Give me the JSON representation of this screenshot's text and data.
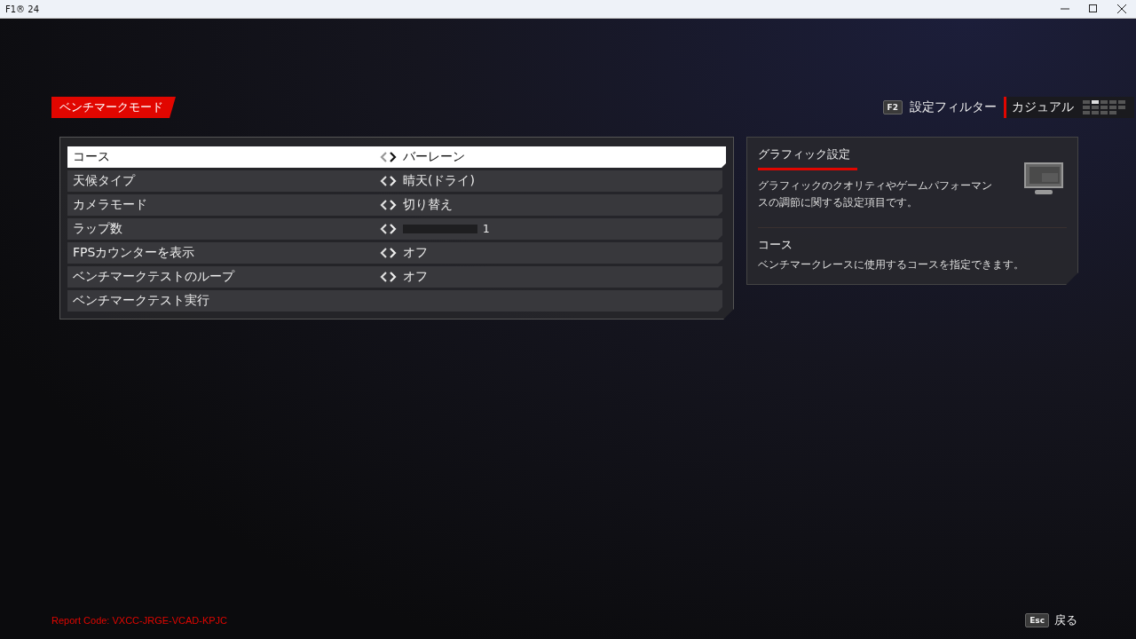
{
  "window": {
    "title": "F1® 24"
  },
  "header": {
    "title": "ベンチマークモード",
    "filter_key": "F2",
    "filter_label": "設定フィルター",
    "filter_value": "カジュアル"
  },
  "settings": [
    {
      "kind": "selector",
      "label": "コース",
      "value": "バーレーン",
      "selected": true
    },
    {
      "kind": "selector",
      "label": "天候タイプ",
      "value": "晴天(ドライ)",
      "selected": false
    },
    {
      "kind": "selector",
      "label": "カメラモード",
      "value": "切り替え",
      "selected": false
    },
    {
      "kind": "slider",
      "label": "ラップ数",
      "value": "1",
      "level": 0,
      "selected": false
    },
    {
      "kind": "selector",
      "label": "FPSカウンターを表示",
      "value": "オフ",
      "selected": false
    },
    {
      "kind": "selector",
      "label": "ベンチマークテストのループ",
      "value": "オフ",
      "selected": false
    },
    {
      "kind": "action",
      "label": "ベンチマークテスト実行",
      "selected": false
    }
  ],
  "info": {
    "title": "グラフィック設定",
    "description": "グラフィックのクオリティやゲームパフォーマンスの調節に関する設定項目です。",
    "item_title": "コース",
    "item_description": "ベンチマークレースに使用するコースを指定できます。"
  },
  "footer": {
    "report_code": "Report Code: VXCC-JRGE-VCAD-KPJC",
    "back_key": "Esc",
    "back_label": "戻る"
  }
}
